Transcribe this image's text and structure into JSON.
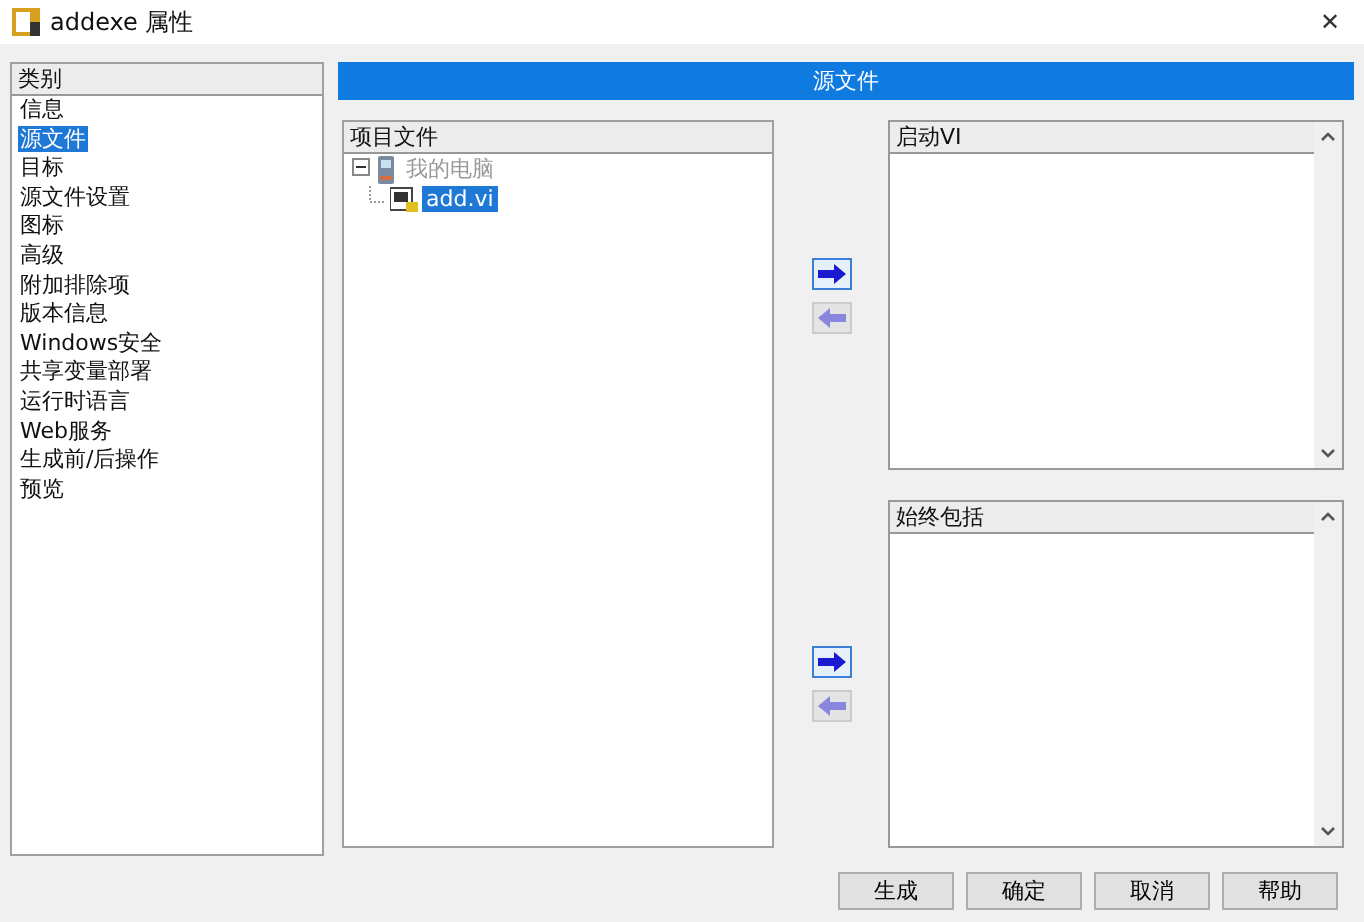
{
  "window": {
    "title": "addexe 属性",
    "close": "✕"
  },
  "categories": {
    "heading": "类别",
    "items": [
      {
        "label": "信息",
        "selected": false
      },
      {
        "label": "源文件",
        "selected": true
      },
      {
        "label": "目标",
        "selected": false
      },
      {
        "label": "源文件设置",
        "selected": false
      },
      {
        "label": "图标",
        "selected": false
      },
      {
        "label": "高级",
        "selected": false
      },
      {
        "label": "附加排除项",
        "selected": false
      },
      {
        "label": "版本信息",
        "selected": false
      },
      {
        "label": "Windows安全",
        "selected": false
      },
      {
        "label": "共享变量部署",
        "selected": false
      },
      {
        "label": "运行时语言",
        "selected": false
      },
      {
        "label": "Web服务",
        "selected": false
      },
      {
        "label": "生成前/后操作",
        "selected": false
      },
      {
        "label": "预览",
        "selected": false
      }
    ]
  },
  "page_title": "源文件",
  "project_files": {
    "heading": "项目文件",
    "tree": [
      {
        "label": "我的电脑",
        "expanded": true,
        "children": [
          {
            "label": "add.vi",
            "selected": true
          }
        ]
      }
    ]
  },
  "transfer_groups": [
    {
      "arrows": [
        {
          "kind": "add",
          "disabled": false
        },
        {
          "kind": "remove",
          "disabled": true
        }
      ],
      "target": {
        "heading": "启动VI"
      }
    },
    {
      "arrows": [
        {
          "kind": "add",
          "disabled": false
        },
        {
          "kind": "remove",
          "disabled": true
        }
      ],
      "target": {
        "heading": "始终包括"
      }
    }
  ],
  "buttons": [
    "生成",
    "确定",
    "取消",
    "帮助"
  ]
}
